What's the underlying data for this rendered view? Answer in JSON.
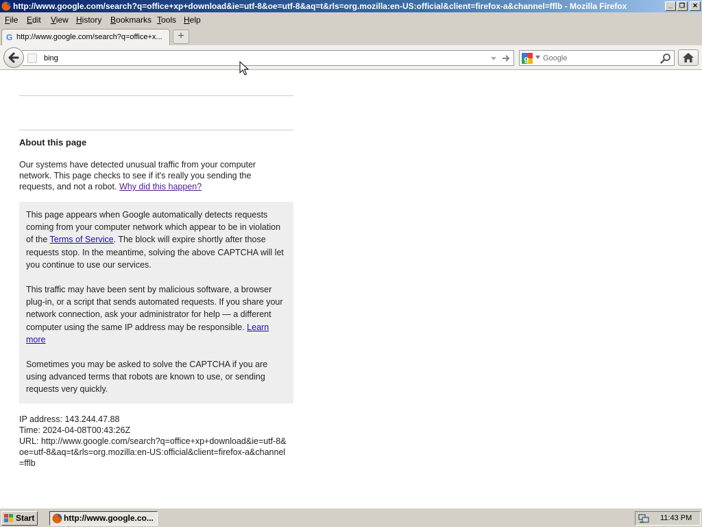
{
  "window": {
    "title": "http://www.google.com/search?q=office+xp+download&ie=utf-8&oe=utf-8&aq=t&rls=org.mozilla:en-US:official&client=firefox-a&channel=fflb - Mozilla Firefox",
    "buttons": {
      "minimize": "_",
      "restore": "❐",
      "close": "✕"
    }
  },
  "menu": {
    "items": [
      {
        "label": "File",
        "u": "F",
        "rest": "ile"
      },
      {
        "label": "Edit",
        "u": "E",
        "rest": "dit"
      },
      {
        "label": "View",
        "u": "V",
        "rest": "iew"
      },
      {
        "label": "History",
        "u": "H",
        "rest": "istory"
      },
      {
        "label": "Bookmarks",
        "u": "B",
        "rest": "ookmarks"
      },
      {
        "label": "Tools",
        "u": "T",
        "rest": "ools"
      },
      {
        "label": "Help",
        "u": "H",
        "rest": "elp"
      }
    ]
  },
  "tabs": [
    {
      "label": "http://www.google.com/search?q=office+x..."
    }
  ],
  "new_tab_label": "+",
  "nav": {
    "url_value": "bing",
    "search_placeholder": "Google",
    "search_engine_icon": "google-icon"
  },
  "page": {
    "about_title": "About this page",
    "intro_text": "Our systems have detected unusual traffic from your computer network. This page checks to see if it's really you sending the requests, and not a robot. ",
    "intro_link": "Why did this happen?",
    "box_p1_before": "This page appears when Google automatically detects requests coming from your computer network which appear to be in violation of the ",
    "box_p1_link": "Terms of Service",
    "box_p1_after": ". The block will expire shortly after those requests stop. In the meantime, solving the above CAPTCHA will let you continue to use our services.",
    "box_p2": "This traffic may have been sent by malicious software, a browser plug-in, or a script that sends automated requests. If you share your network connection, ask your administrator for help — a different computer using the same IP address may be responsible. ",
    "box_p2_link": "Learn more",
    "box_p3": "Sometimes you may be asked to solve the CAPTCHA if you are using advanced terms that robots are known to use, or sending requests very quickly.",
    "ip_line": "IP address: 143.244.47.88",
    "time_line": "Time: 2024-04-08T00:43:26Z",
    "url_line": "URL: http://www.google.com/search?q=office+xp+download&ie=utf-8&oe=utf-8&aq=t&rls=org.mozilla:en-US:official&client=firefox-a&channel=fflb"
  },
  "taskbar": {
    "start_label": "Start",
    "task_label": "http://www.google.co...",
    "clock": "11:43 PM"
  },
  "colors": {
    "titlebar": "#0a246a",
    "chrome": "#d4d0c8",
    "link_visited": "#551a8b",
    "link": "#1a0dab",
    "info_box": "#eeeeee"
  }
}
